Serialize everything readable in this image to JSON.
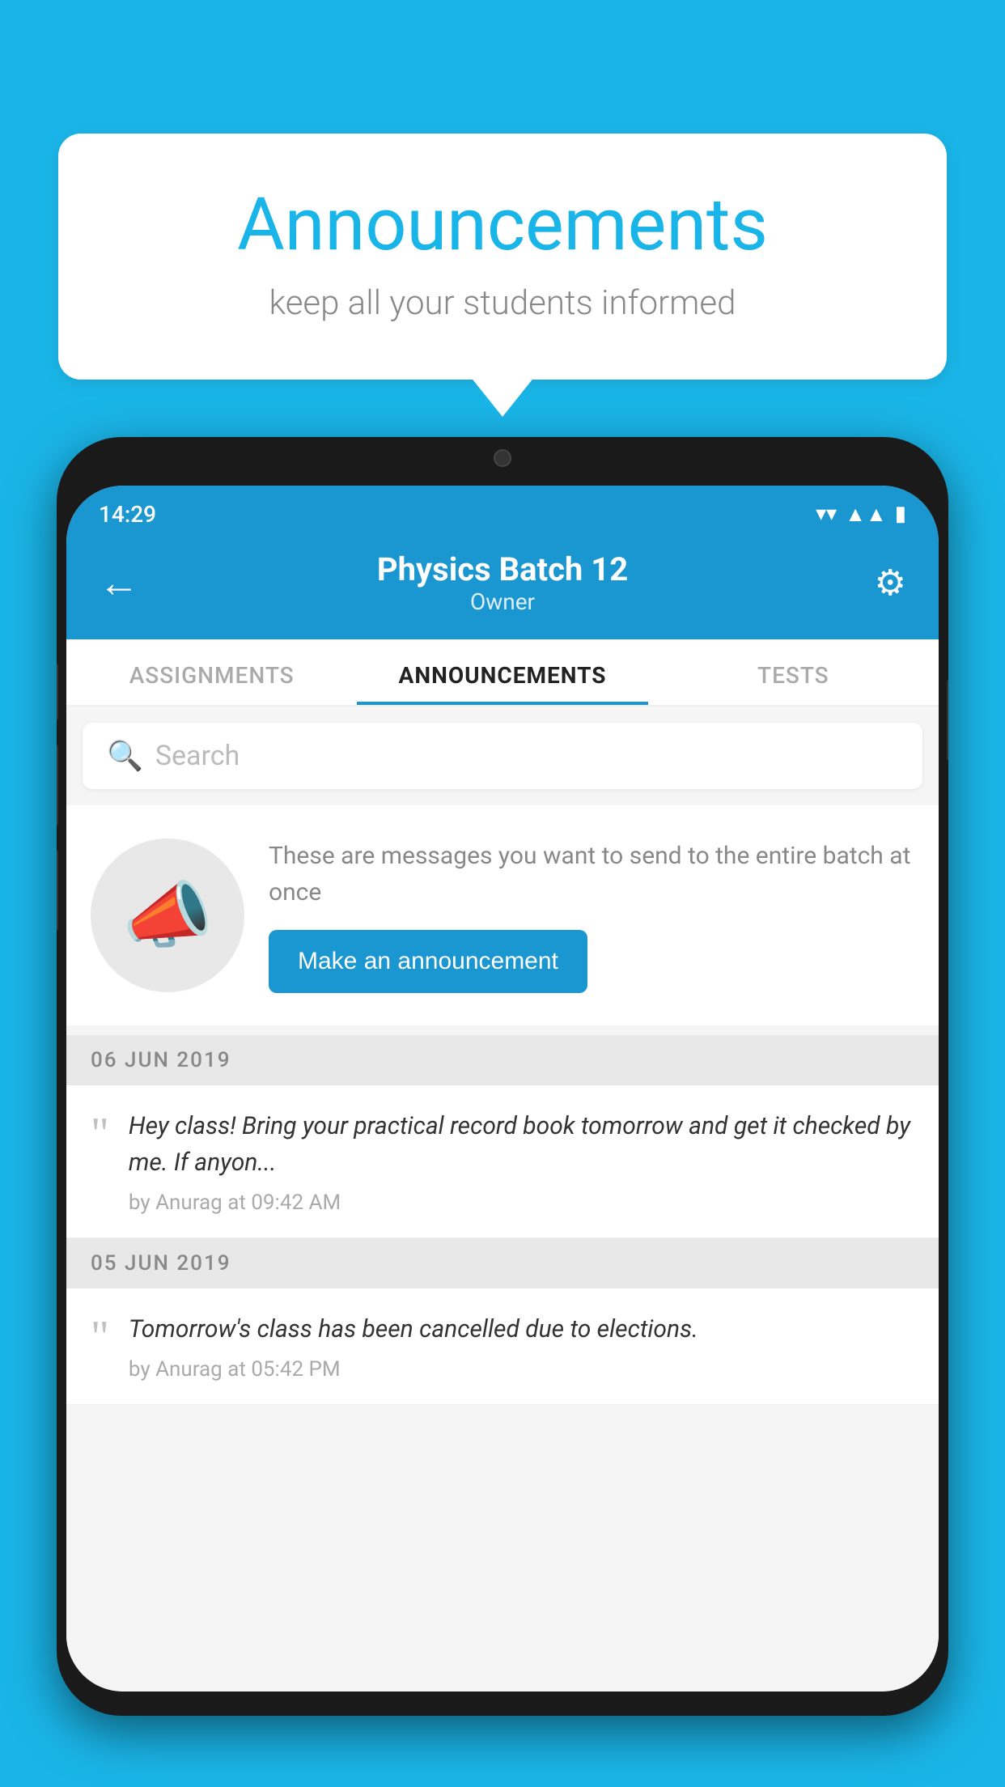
{
  "background_color": "#1ab5e8",
  "speech_bubble": {
    "title": "Announcements",
    "subtitle": "keep all your students informed"
  },
  "phone": {
    "status_bar": {
      "time": "14:29",
      "icons": [
        "wifi",
        "signal",
        "battery"
      ]
    },
    "header": {
      "title": "Physics Batch 12",
      "subtitle": "Owner",
      "back_label": "←",
      "gear_label": "⚙"
    },
    "tabs": [
      {
        "label": "ASSIGNMENTS",
        "active": false
      },
      {
        "label": "ANNOUNCEMENTS",
        "active": true
      },
      {
        "label": "TESTS",
        "active": false
      }
    ],
    "search": {
      "placeholder": "Search"
    },
    "promo": {
      "description": "These are messages you want to send to the entire batch at once",
      "button_label": "Make an announcement"
    },
    "announcements": [
      {
        "date": "06  JUN  2019",
        "message": "Hey class! Bring your practical record book tomorrow and get it checked by me. If anyon...",
        "meta": "by Anurag at 09:42 AM"
      },
      {
        "date": "05  JUN  2019",
        "message": "Tomorrow's class has been cancelled due to elections.",
        "meta": "by Anurag at 05:42 PM"
      }
    ]
  }
}
